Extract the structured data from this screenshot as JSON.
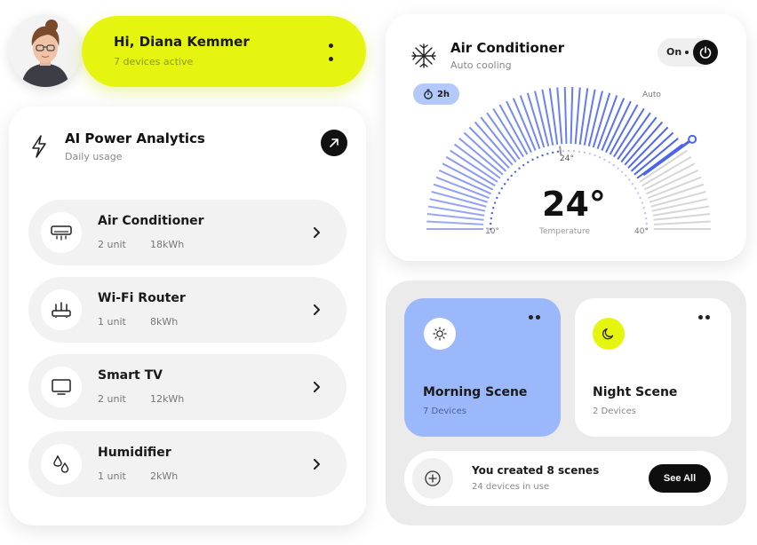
{
  "user": {
    "greeting": "Hi, Diana Kemmer",
    "devices_active": "7 devices active"
  },
  "analytics": {
    "title": "AI Power Analytics",
    "subtitle": "Daily usage",
    "devices": [
      {
        "name": "Air Conditioner",
        "units": "2 unit",
        "usage": "18kWh",
        "icon": "air-conditioner-icon"
      },
      {
        "name": "Wi-Fi Router",
        "units": "1 unit",
        "usage": "8kWh",
        "icon": "router-icon"
      },
      {
        "name": "Smart TV",
        "units": "2 unit",
        "usage": "12kWh",
        "icon": "tv-icon"
      },
      {
        "name": "Humidifier",
        "units": "1 unit",
        "usage": "2kWh",
        "icon": "humidifier-icon"
      }
    ]
  },
  "ac": {
    "title": "Air Conditioner",
    "subtitle": "Auto cooling",
    "power_label": "On",
    "timer": "2h",
    "temperature": "24°",
    "temperature_label": "Temperature",
    "set_point_label": "24°",
    "min_label": "10°",
    "max_label": "40°",
    "mode_label": "Auto",
    "gauge": {
      "min": 10,
      "max": 40,
      "value": 24,
      "mode_marker": 34
    },
    "accent": "#4a63f0"
  },
  "scenes": {
    "items": [
      {
        "name": "Morning Scene",
        "devices": "7 Devices",
        "icon": "sun-icon",
        "color": "#9bb8fb"
      },
      {
        "name": "Night Scene",
        "devices": "2 Devices",
        "icon": "moon-icon",
        "color": "#e6f50f"
      }
    ],
    "created_title": "You created 8 scenes",
    "created_sub": "24 devices in use",
    "see_all_label": "See All"
  }
}
